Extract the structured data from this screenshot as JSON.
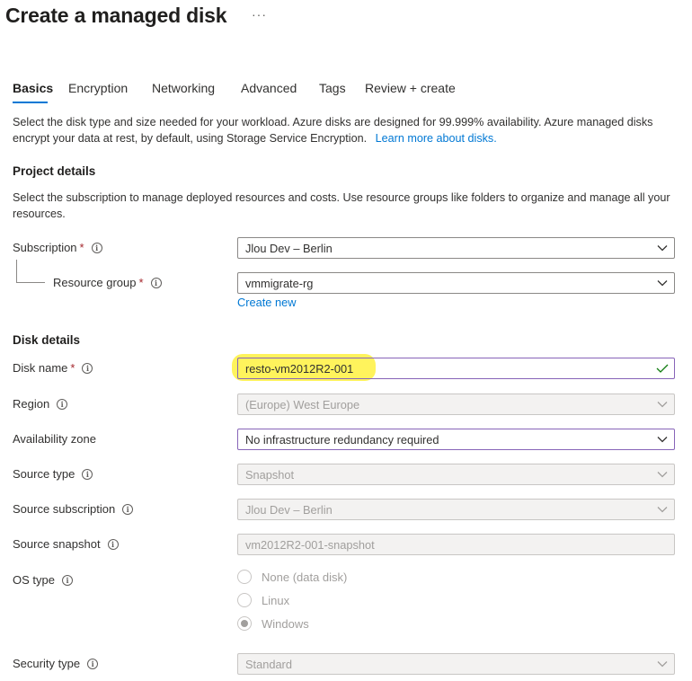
{
  "header": {
    "title": "Create a managed disk",
    "more": "···"
  },
  "tabs": [
    "Basics",
    "Encryption",
    "Networking",
    "Advanced",
    "Tags",
    "Review + create"
  ],
  "intro": {
    "text": "Select the disk type and size needed for your workload. Azure disks are designed for 99.999% availability. Azure managed disks encrypt your data at rest, by default, using Storage Service Encryption.",
    "link": "Learn more about disks."
  },
  "project": {
    "heading": "Project details",
    "desc": "Select the subscription to manage deployed resources and costs. Use resource groups like folders to organize and manage all your resources.",
    "subscription_label": "Subscription",
    "subscription_value": "Jlou Dev – Berlin",
    "rg_label": "Resource group",
    "rg_value": "vmmigrate-rg",
    "create_new": "Create new"
  },
  "disk": {
    "heading": "Disk details",
    "name_label": "Disk name",
    "name_value": "resto-vm2012R2-001",
    "region_label": "Region",
    "region_value": "(Europe) West Europe",
    "az_label": "Availability zone",
    "az_value": "No infrastructure redundancy required",
    "source_type_label": "Source type",
    "source_type_value": "Snapshot",
    "source_sub_label": "Source subscription",
    "source_sub_value": "Jlou Dev – Berlin",
    "source_snap_label": "Source snapshot",
    "source_snap_value": "vm2012R2-001-snapshot",
    "os_label": "OS type",
    "os_options": [
      "None (data disk)",
      "Linux",
      "Windows"
    ],
    "os_selected": "Windows",
    "security_label": "Security type",
    "security_value": "Standard"
  },
  "required_mark": "*",
  "info_glyph": "i",
  "colors": {
    "accent": "#0078d4",
    "required": "#a4262c",
    "valid": "#107c10",
    "highlight": "#fff24a",
    "focus": "#8764b8"
  }
}
